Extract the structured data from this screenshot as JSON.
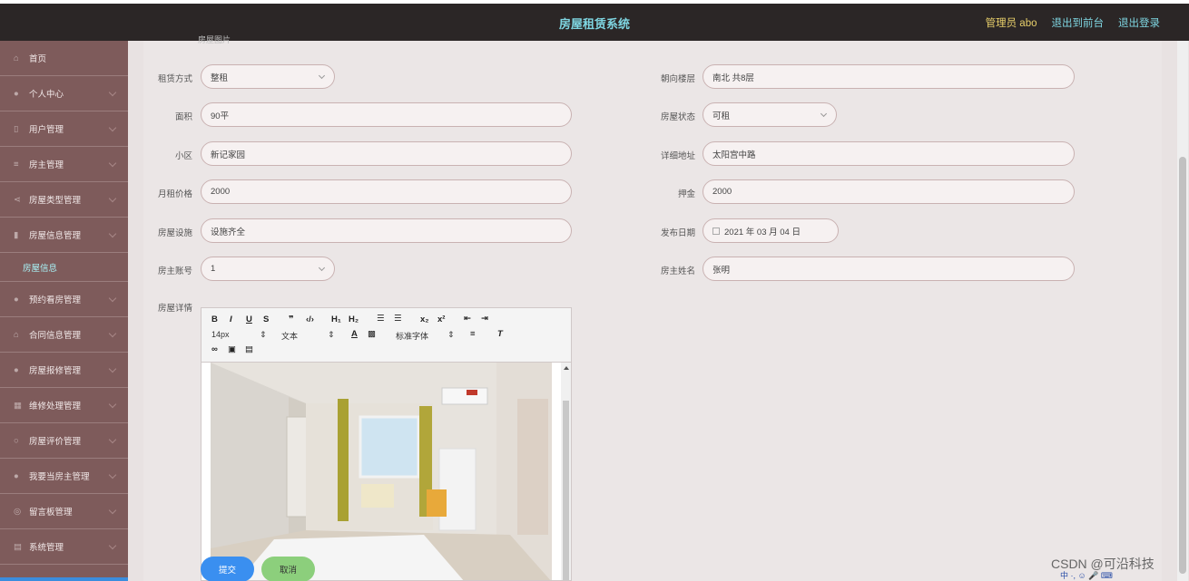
{
  "header": {
    "title": "房屋租赁系统",
    "admin": "管理员 abo",
    "back_front": "退出到前台",
    "logout": "退出登录"
  },
  "sidebar": {
    "items": [
      {
        "label": "首页"
      },
      {
        "label": "个人中心"
      },
      {
        "label": "用户管理"
      },
      {
        "label": "房主管理"
      },
      {
        "label": "房屋类型管理"
      },
      {
        "label": "房屋信息管理"
      },
      {
        "label": "预约看房管理"
      },
      {
        "label": "合同信息管理"
      },
      {
        "label": "房屋报修管理"
      },
      {
        "label": "维修处理管理"
      },
      {
        "label": "房屋评价管理"
      },
      {
        "label": "我要当房主管理"
      },
      {
        "label": "留言板管理"
      },
      {
        "label": "系统管理"
      }
    ],
    "active_sub": "房屋信息"
  },
  "form": {
    "faded_top": "房屋图片",
    "rent_type": {
      "label": "租赁方式",
      "value": "整租"
    },
    "orientation": {
      "label": "朝向楼层",
      "value": "南北 共8层"
    },
    "area": {
      "label": "面积",
      "value": "90平"
    },
    "status": {
      "label": "房屋状态",
      "value": "可租"
    },
    "community": {
      "label": "小区",
      "value": "新记家园"
    },
    "address": {
      "label": "详细地址",
      "value": "太阳宫中路"
    },
    "monthly_rent": {
      "label": "月租价格",
      "value": "2000"
    },
    "deposit": {
      "label": "押金",
      "value": "2000"
    },
    "facilities": {
      "label": "房屋设施",
      "value": "设施齐全"
    },
    "publish_date": {
      "label": "发布日期",
      "value": "2021 年 03 月 04 日"
    },
    "owner_account": {
      "label": "房主账号",
      "value": "1"
    },
    "owner_name": {
      "label": "房主姓名",
      "value": "张明"
    },
    "details": {
      "label": "房屋详情"
    }
  },
  "editor": {
    "font_size": "14px",
    "block_type": "文本",
    "font_family": "标准字体"
  },
  "buttons": {
    "submit": "提交",
    "cancel": "取消"
  },
  "watermark": "CSDN @可沿科技",
  "tray": "中 ·, ☺ 🎤 ⌨"
}
